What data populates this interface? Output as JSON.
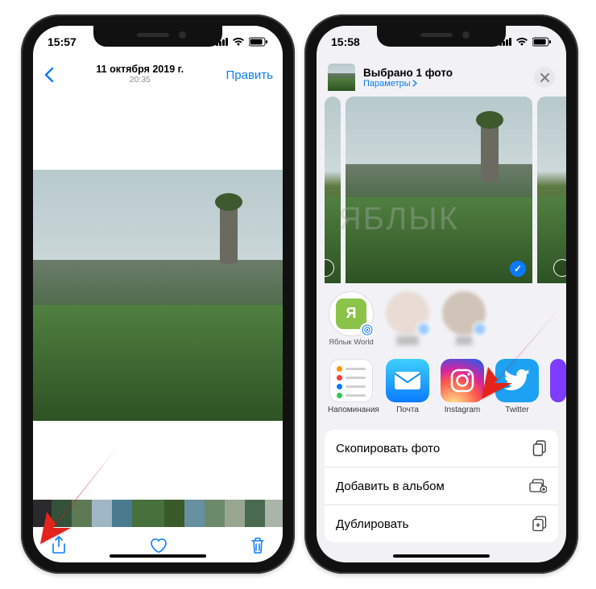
{
  "left": {
    "status_time": "15:57",
    "nav_date": "11 октября 2019 г.",
    "nav_time": "20:35",
    "edit_label": "Править"
  },
  "right": {
    "status_time": "15:58",
    "share_title": "Выбрано 1 фото",
    "share_options": "Параметры",
    "airdrop": [
      {
        "label": "Яблык World"
      },
      {
        "label": ""
      },
      {
        "label": ""
      }
    ],
    "apps": [
      {
        "label": "Напоминания"
      },
      {
        "label": "Почта"
      },
      {
        "label": "Instagram"
      },
      {
        "label": "Twitter"
      }
    ],
    "actions": {
      "copy": "Скопировать фото",
      "add_album": "Добавить в альбом",
      "duplicate": "Дублировать"
    }
  },
  "watermark": "ЯБЛЫК"
}
